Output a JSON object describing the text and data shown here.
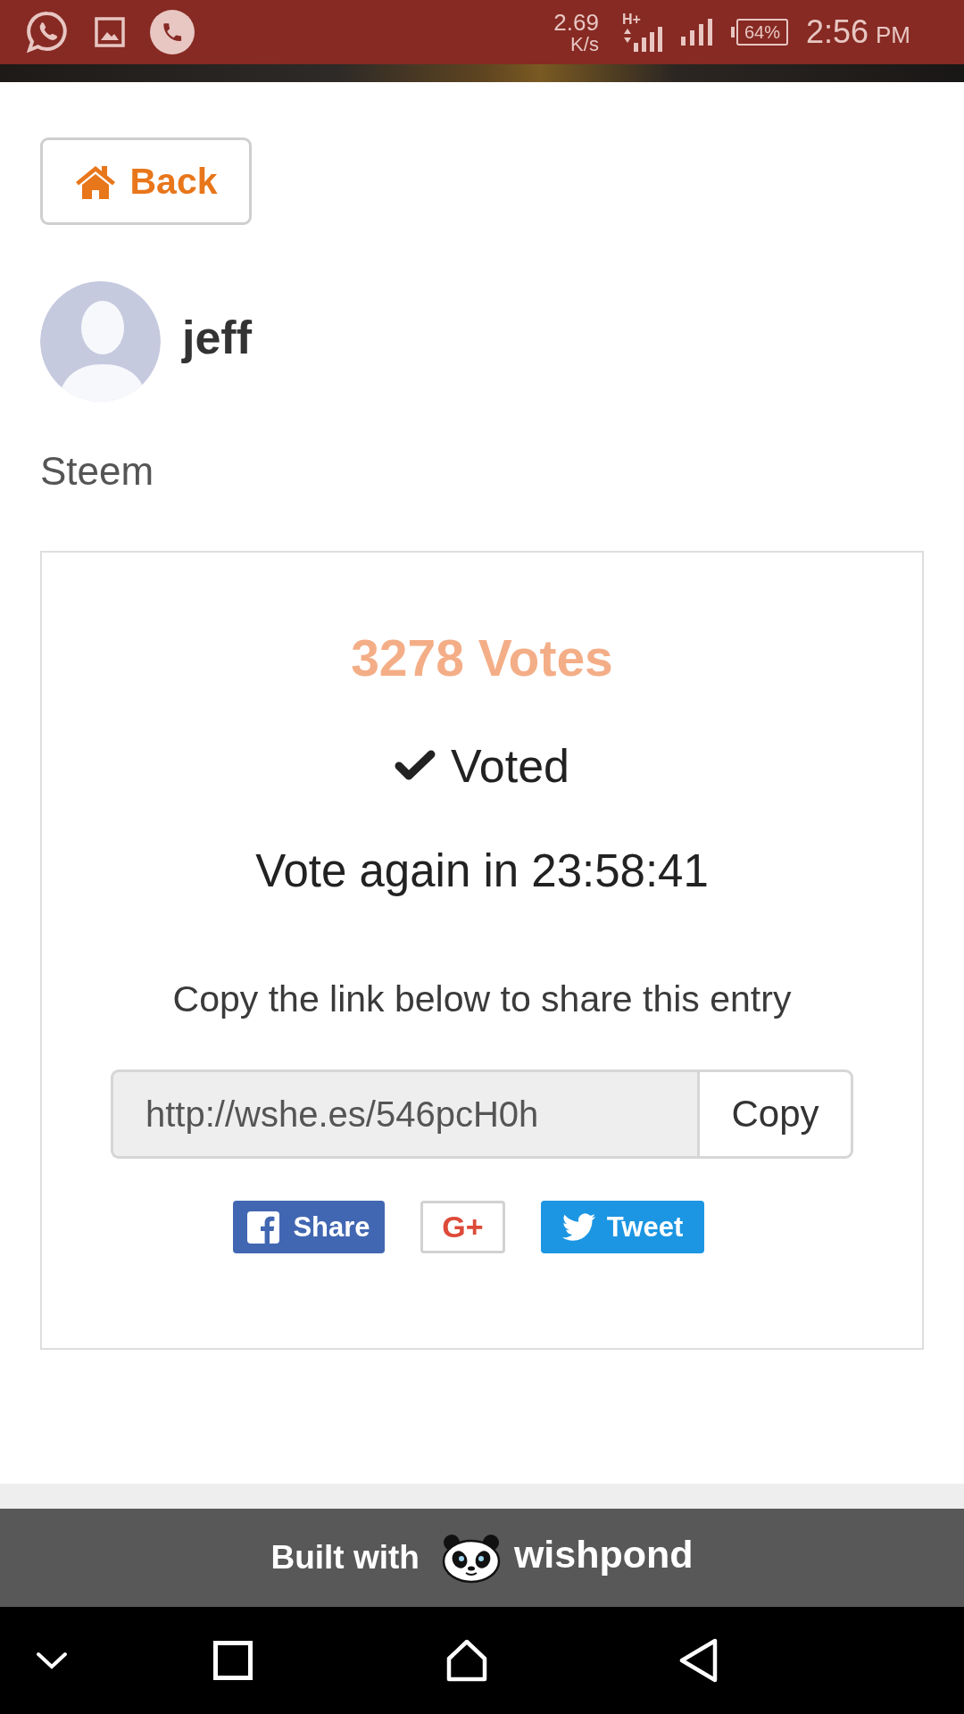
{
  "status_bar": {
    "data_rate": "2.69",
    "data_rate_unit": "K/s",
    "network_type": "H+",
    "battery": "64%",
    "time": "2:56",
    "time_period": "PM"
  },
  "back_button": {
    "label": "Back"
  },
  "profile": {
    "name": "jeff",
    "subtitle": "Steem"
  },
  "vote_card": {
    "votes": "3278 Votes",
    "status": "Voted",
    "countdown": "Vote again in 23:58:41",
    "share_prompt": "Copy the link below to share this entry",
    "link_field": {
      "value": "http://wshe.es/546pcH0h"
    },
    "copy_button": "Copy",
    "share_buttons": [
      {
        "kind": "facebook",
        "label": "Share"
      },
      {
        "kind": "google_plus",
        "label": "G+"
      },
      {
        "kind": "twitter",
        "label": "Tweet"
      }
    ]
  },
  "footer": {
    "prefix": "Built with",
    "brand": "wishpond"
  }
}
